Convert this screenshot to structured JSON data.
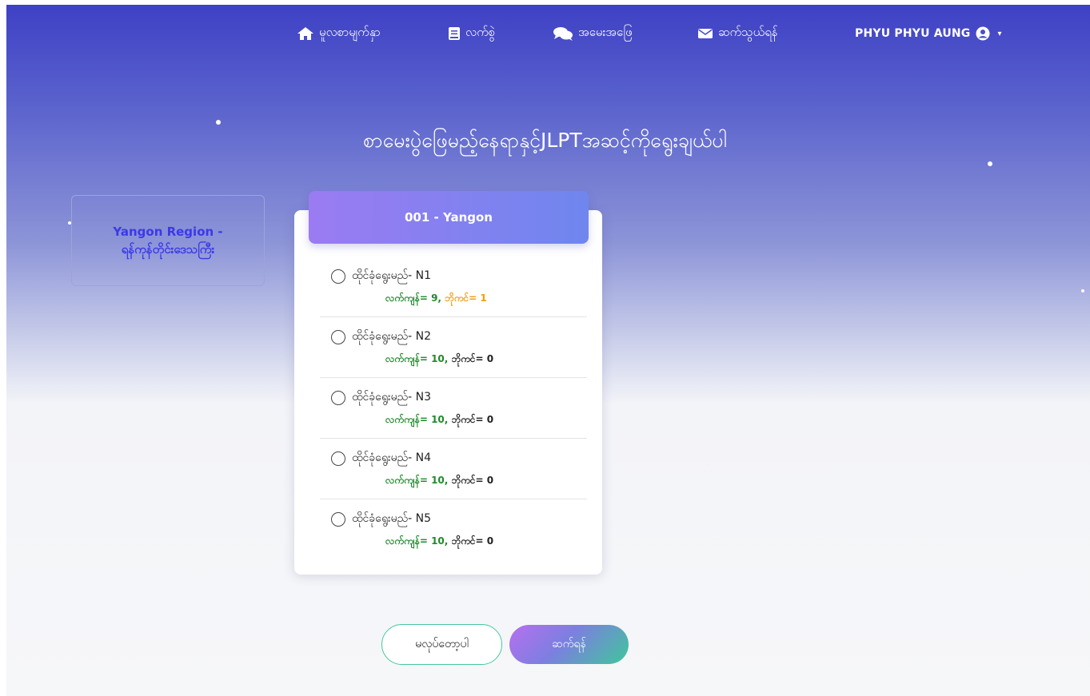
{
  "nav": {
    "home": {
      "icon": "home-icon",
      "label": "မူလစာမျက်နှာ"
    },
    "book": {
      "icon": "book-icon",
      "label": "လက်စွဲ"
    },
    "faq": {
      "icon": "chat-icon",
      "label": "အမေးအဖြေ"
    },
    "contact": {
      "icon": "envelope-icon",
      "label": "ဆက်သွယ်ရန်"
    },
    "user": {
      "icon": "user-circle-icon",
      "name": "PHYU PHYU AUNG",
      "caret": "▾"
    }
  },
  "title": "စာမေးပွဲဖြေမည့်နေရာနှင့်JLPTအဆင့်ကိုရွေးချယ်ပါ",
  "region": {
    "line1": "Yangon Region -",
    "line2": "ရန်ကုန်တိုင်းဒေသကြီး"
  },
  "venue": {
    "header": "001 - Yangon"
  },
  "options": [
    {
      "label": "ထိုင်ခုံရွေးမည်- N1",
      "remaining": "လက်ကျန်= 9,",
      "waiting": "ဘိုကင်= 1",
      "selected": false
    },
    {
      "label": "ထိုင်ခုံရွေးမည်- N2",
      "remaining": "လက်ကျန်= 10,",
      "waiting": "ဘိုကင်= 0",
      "selected": false
    },
    {
      "label": "ထိုင်ခုံရွေးမည်- N3",
      "remaining": "လက်ကျန်= 10,",
      "waiting": "ဘိုကင်= 0",
      "selected": false
    },
    {
      "label": "ထိုင်ခုံရွေးမည်- N4",
      "remaining": "လက်ကျန်= 10,",
      "waiting": "ဘိုကင်= 0",
      "selected": false
    },
    {
      "label": "ထိုင်ခုံရွေးမည်- N5",
      "remaining": "လက်ကျန်= 10,",
      "waiting": "ဘိုကင်= 0",
      "selected": false
    }
  ],
  "buttons": {
    "back": "မလုပ်တော့ပါ",
    "next": "ဆက်ရန်"
  },
  "colors": {
    "remaining": "#1f8a2a",
    "waiting_highlight": "#f39c12",
    "region_text": "#3b39e6"
  }
}
